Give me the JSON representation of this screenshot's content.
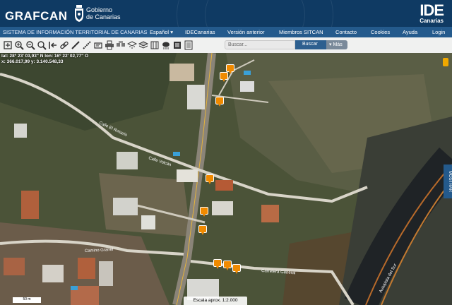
{
  "header": {
    "brand": "GRAFCAN",
    "gov_line1": "Gobierno",
    "gov_line2": "de Canarias",
    "ide_big": "IDE",
    "ide_small": "Canarias"
  },
  "nav": {
    "title": "SISTEMA DE INFORMACIÓN TERRITORIAL DE CANARIAS",
    "items": [
      {
        "label": "Español"
      },
      {
        "label": "IDECanarias"
      },
      {
        "label": "Versión anterior"
      },
      {
        "label": "Miembros SITCAN"
      },
      {
        "label": "Contacto"
      },
      {
        "label": "Cookies"
      },
      {
        "label": "Ayuda"
      },
      {
        "label": "Login"
      }
    ],
    "language_arrow": "▾"
  },
  "toolbar": {
    "tools": [
      {
        "icon": "zoom-extent-icon"
      },
      {
        "icon": "zoom-in-icon"
      },
      {
        "icon": "zoom-out-icon"
      },
      {
        "icon": "search-icon"
      },
      {
        "icon": "previous-view-icon"
      },
      {
        "icon": "link-icon"
      },
      {
        "icon": "measure-distance-icon"
      },
      {
        "icon": "measure-area-icon"
      },
      {
        "icon": "draw-icon"
      },
      {
        "icon": "print-icon"
      },
      {
        "icon": "share-icon"
      },
      {
        "icon": "layers-icon"
      },
      {
        "icon": "3d-view-icon"
      },
      {
        "icon": "cloud-icon"
      },
      {
        "icon": "grid-icon"
      },
      {
        "icon": "legend-icon"
      }
    ],
    "search_placeholder": "Buscar...",
    "search_button": "Buscar",
    "more_button": "Más"
  },
  "map": {
    "coord_line1": "lat: 28º 23' 03,93\" N  lon: 16º 22' 02,77\" O",
    "coord_line2": "x: 366.017,99  y: 3.140.548,33",
    "side_tab": "MOSTRAR",
    "scale_bar": "50 m",
    "scale_text": "Escala aprox. 1:2.000",
    "road_labels": [
      "Calle El Rosario",
      "Calle Volcán",
      "Camino Granel",
      "Carretera General",
      "Autopista del Sur"
    ]
  }
}
